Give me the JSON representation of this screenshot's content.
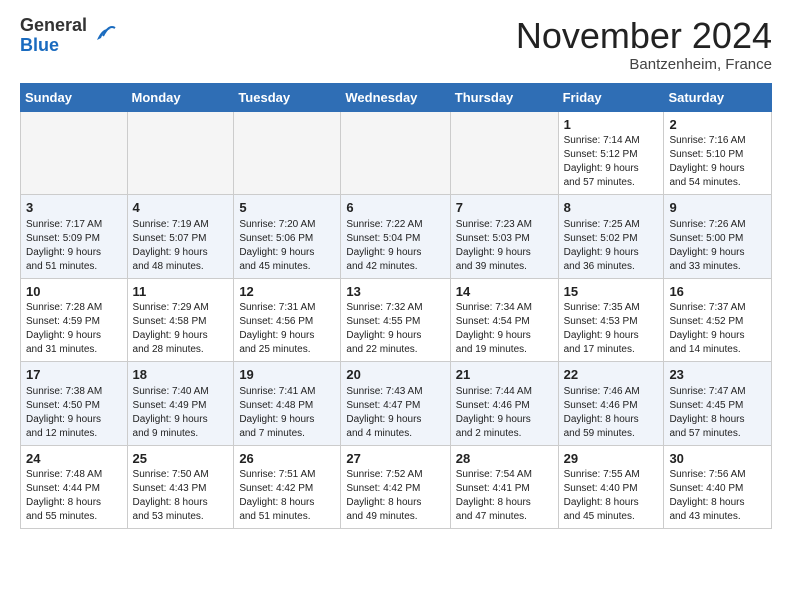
{
  "header": {
    "logo_line1": "General",
    "logo_line2": "Blue",
    "month": "November 2024",
    "location": "Bantzenheim, France"
  },
  "weekdays": [
    "Sunday",
    "Monday",
    "Tuesday",
    "Wednesday",
    "Thursday",
    "Friday",
    "Saturday"
  ],
  "weeks": [
    [
      {
        "day": "",
        "info": ""
      },
      {
        "day": "",
        "info": ""
      },
      {
        "day": "",
        "info": ""
      },
      {
        "day": "",
        "info": ""
      },
      {
        "day": "",
        "info": ""
      },
      {
        "day": "1",
        "info": "Sunrise: 7:14 AM\nSunset: 5:12 PM\nDaylight: 9 hours\nand 57 minutes."
      },
      {
        "day": "2",
        "info": "Sunrise: 7:16 AM\nSunset: 5:10 PM\nDaylight: 9 hours\nand 54 minutes."
      }
    ],
    [
      {
        "day": "3",
        "info": "Sunrise: 7:17 AM\nSunset: 5:09 PM\nDaylight: 9 hours\nand 51 minutes."
      },
      {
        "day": "4",
        "info": "Sunrise: 7:19 AM\nSunset: 5:07 PM\nDaylight: 9 hours\nand 48 minutes."
      },
      {
        "day": "5",
        "info": "Sunrise: 7:20 AM\nSunset: 5:06 PM\nDaylight: 9 hours\nand 45 minutes."
      },
      {
        "day": "6",
        "info": "Sunrise: 7:22 AM\nSunset: 5:04 PM\nDaylight: 9 hours\nand 42 minutes."
      },
      {
        "day": "7",
        "info": "Sunrise: 7:23 AM\nSunset: 5:03 PM\nDaylight: 9 hours\nand 39 minutes."
      },
      {
        "day": "8",
        "info": "Sunrise: 7:25 AM\nSunset: 5:02 PM\nDaylight: 9 hours\nand 36 minutes."
      },
      {
        "day": "9",
        "info": "Sunrise: 7:26 AM\nSunset: 5:00 PM\nDaylight: 9 hours\nand 33 minutes."
      }
    ],
    [
      {
        "day": "10",
        "info": "Sunrise: 7:28 AM\nSunset: 4:59 PM\nDaylight: 9 hours\nand 31 minutes."
      },
      {
        "day": "11",
        "info": "Sunrise: 7:29 AM\nSunset: 4:58 PM\nDaylight: 9 hours\nand 28 minutes."
      },
      {
        "day": "12",
        "info": "Sunrise: 7:31 AM\nSunset: 4:56 PM\nDaylight: 9 hours\nand 25 minutes."
      },
      {
        "day": "13",
        "info": "Sunrise: 7:32 AM\nSunset: 4:55 PM\nDaylight: 9 hours\nand 22 minutes."
      },
      {
        "day": "14",
        "info": "Sunrise: 7:34 AM\nSunset: 4:54 PM\nDaylight: 9 hours\nand 19 minutes."
      },
      {
        "day": "15",
        "info": "Sunrise: 7:35 AM\nSunset: 4:53 PM\nDaylight: 9 hours\nand 17 minutes."
      },
      {
        "day": "16",
        "info": "Sunrise: 7:37 AM\nSunset: 4:52 PM\nDaylight: 9 hours\nand 14 minutes."
      }
    ],
    [
      {
        "day": "17",
        "info": "Sunrise: 7:38 AM\nSunset: 4:50 PM\nDaylight: 9 hours\nand 12 minutes."
      },
      {
        "day": "18",
        "info": "Sunrise: 7:40 AM\nSunset: 4:49 PM\nDaylight: 9 hours\nand 9 minutes."
      },
      {
        "day": "19",
        "info": "Sunrise: 7:41 AM\nSunset: 4:48 PM\nDaylight: 9 hours\nand 7 minutes."
      },
      {
        "day": "20",
        "info": "Sunrise: 7:43 AM\nSunset: 4:47 PM\nDaylight: 9 hours\nand 4 minutes."
      },
      {
        "day": "21",
        "info": "Sunrise: 7:44 AM\nSunset: 4:46 PM\nDaylight: 9 hours\nand 2 minutes."
      },
      {
        "day": "22",
        "info": "Sunrise: 7:46 AM\nSunset: 4:46 PM\nDaylight: 8 hours\nand 59 minutes."
      },
      {
        "day": "23",
        "info": "Sunrise: 7:47 AM\nSunset: 4:45 PM\nDaylight: 8 hours\nand 57 minutes."
      }
    ],
    [
      {
        "day": "24",
        "info": "Sunrise: 7:48 AM\nSunset: 4:44 PM\nDaylight: 8 hours\nand 55 minutes."
      },
      {
        "day": "25",
        "info": "Sunrise: 7:50 AM\nSunset: 4:43 PM\nDaylight: 8 hours\nand 53 minutes."
      },
      {
        "day": "26",
        "info": "Sunrise: 7:51 AM\nSunset: 4:42 PM\nDaylight: 8 hours\nand 51 minutes."
      },
      {
        "day": "27",
        "info": "Sunrise: 7:52 AM\nSunset: 4:42 PM\nDaylight: 8 hours\nand 49 minutes."
      },
      {
        "day": "28",
        "info": "Sunrise: 7:54 AM\nSunset: 4:41 PM\nDaylight: 8 hours\nand 47 minutes."
      },
      {
        "day": "29",
        "info": "Sunrise: 7:55 AM\nSunset: 4:40 PM\nDaylight: 8 hours\nand 45 minutes."
      },
      {
        "day": "30",
        "info": "Sunrise: 7:56 AM\nSunset: 4:40 PM\nDaylight: 8 hours\nand 43 minutes."
      }
    ]
  ]
}
